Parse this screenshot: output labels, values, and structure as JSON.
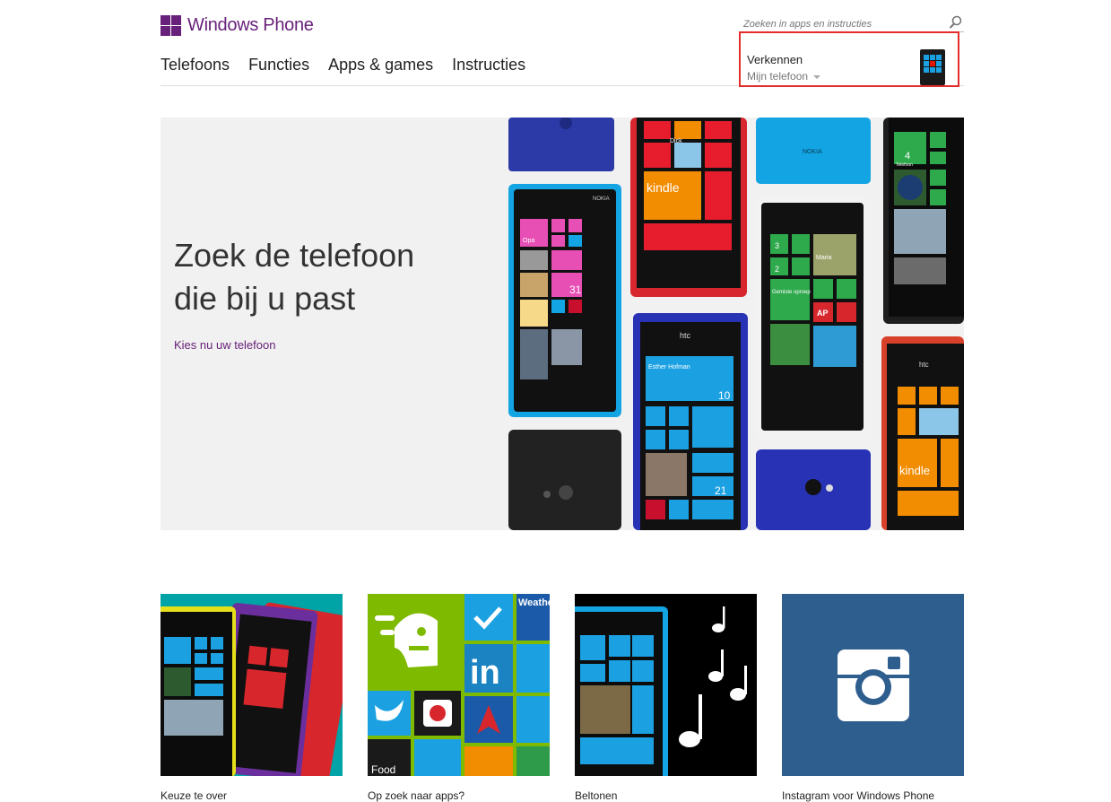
{
  "header": {
    "brand": "Windows Phone",
    "nav": [
      "Telefoons",
      "Functies",
      "Apps & games",
      "Instructies"
    ],
    "search_placeholder": "Zoeken in apps en instructies",
    "explore_title": "Verkennen",
    "explore_sub": "Mijn telefoon"
  },
  "hero": {
    "title_line1": "Zoek de telefoon",
    "title_line2": "die bij u past",
    "link": "Kies nu uw telefoon",
    "phone_text": {
      "nokia_brand": "NOKIA",
      "htc_brand": "htc",
      "tile_opa": "Opa",
      "tile_dick": "Dick",
      "tile_kindle": "kindle",
      "tile_contact": "Esther Hofman",
      "tile_mail_count": "10",
      "tile_cal_day": "31",
      "tile_cal_day2": "21",
      "tile_maria": "Maria",
      "tile_missed": "Gemiste oproep",
      "tile_ap": "AP",
      "tile_phone_count": "4",
      "tile_msg_count": "2",
      "tile_count3": "3",
      "tile_telefoon": "Telefoon"
    }
  },
  "tiles": [
    {
      "caption": "Keuze te over",
      "bg": "#00a4a6"
    },
    {
      "caption": "Op zoek naar apps?",
      "bg": "#7dba00"
    },
    {
      "caption": "Beltonen",
      "bg": "#000000"
    },
    {
      "caption": "Instagram voor Windows Phone",
      "bg": "#2e5e8e",
      "weather_label": "Weather Channel",
      "food_label": "Food"
    }
  ],
  "colors": {
    "brand_purple": "#68217a",
    "highlight_red": "#e32c2c",
    "win_red": "#f25022",
    "win_green": "#7fba00",
    "win_blue": "#00a4ef",
    "win_yellow": "#ffb900"
  }
}
